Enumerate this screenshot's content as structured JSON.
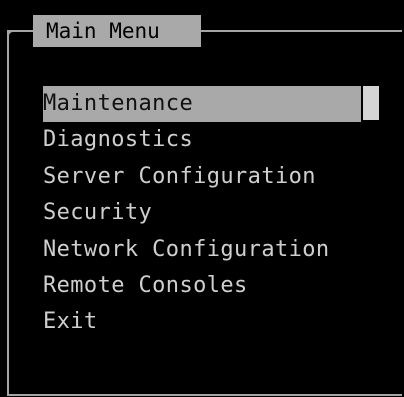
{
  "menu": {
    "title": "Main Menu",
    "items": [
      {
        "label": "Maintenance",
        "selected": true
      },
      {
        "label": "Diagnostics",
        "selected": false
      },
      {
        "label": "Server Configuration",
        "selected": false
      },
      {
        "label": "Security",
        "selected": false
      },
      {
        "label": "Network Configuration",
        "selected": false
      },
      {
        "label": "Remote Consoles",
        "selected": false
      },
      {
        "label": "Exit",
        "selected": false
      }
    ]
  },
  "colors": {
    "background": "#000000",
    "highlight": "#a9a9a9",
    "text": "#cfcfcf",
    "border": "#a4a4a4"
  }
}
